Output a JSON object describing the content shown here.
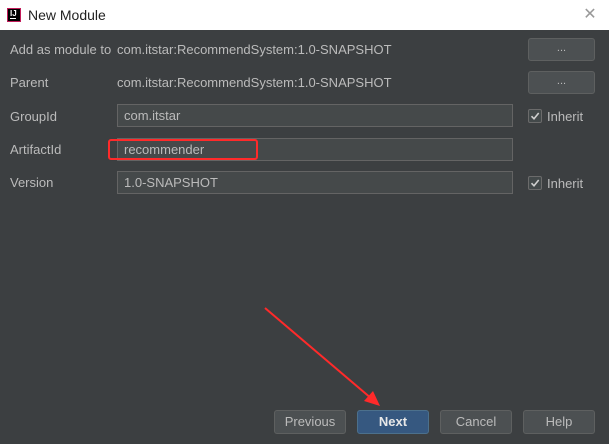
{
  "window": {
    "title": "New Module",
    "close_glyph": "✕"
  },
  "form": {
    "add_as_module": {
      "label": "Add as module to",
      "value": "com.itstar:RecommendSystem:1.0-SNAPSHOT",
      "button": "..."
    },
    "parent": {
      "label": "Parent",
      "value": "com.itstar:RecommendSystem:1.0-SNAPSHOT",
      "button": "..."
    },
    "group_id": {
      "label": "GroupId",
      "value": "com.itstar",
      "inherit_label": "Inherit",
      "inherit_checked": true
    },
    "artifact_id": {
      "label": "ArtifactId",
      "value": "recommender"
    },
    "version": {
      "label": "Version",
      "value": "1.0-SNAPSHOT",
      "inherit_label": "Inherit",
      "inherit_checked": true
    }
  },
  "buttons": {
    "previous": "Previous",
    "next": "Next",
    "cancel": "Cancel",
    "help": "Help"
  },
  "annotations": {
    "highlight_color": "#ff2a2a",
    "arrow_color": "#ff2a2a"
  },
  "colors": {
    "dialog_bg": "#3c3f41",
    "default_button": "#365880"
  }
}
